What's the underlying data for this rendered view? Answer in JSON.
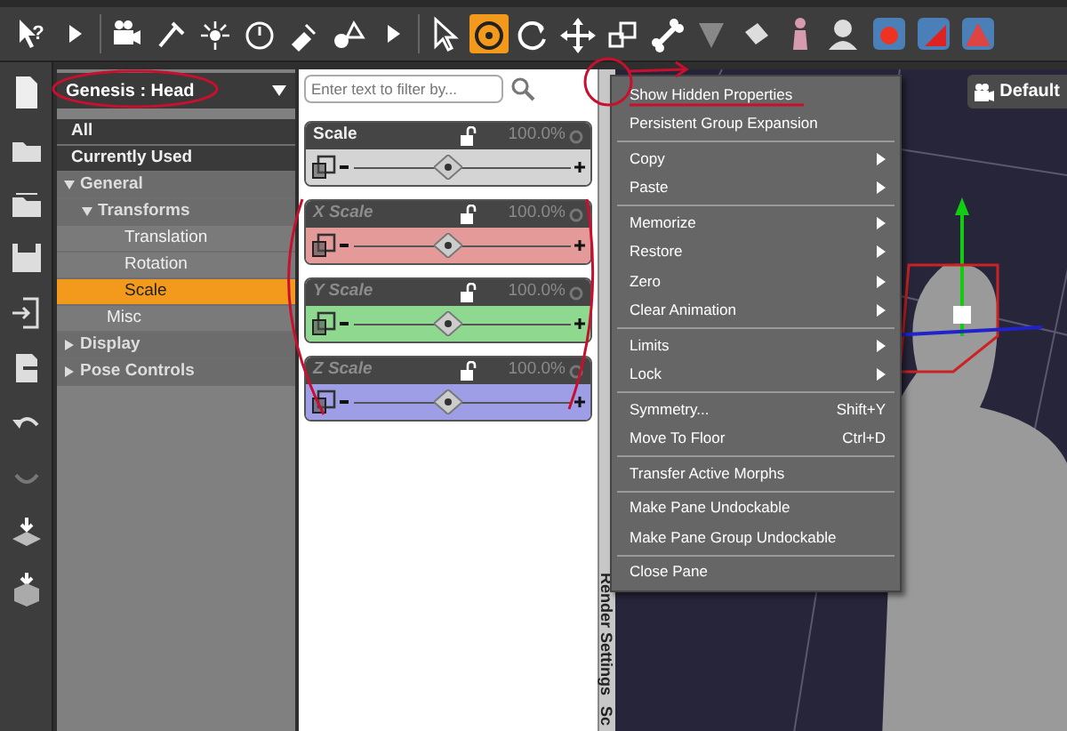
{
  "toolbar": {
    "tools": [
      {
        "selected": false,
        "label": "?"
      },
      {
        "selected": false
      },
      {
        "selected": false
      },
      {
        "selected": false
      },
      {
        "selected": false
      },
      {
        "selected": false
      },
      {
        "selected": false
      },
      {
        "selected": false
      },
      {
        "selected": false
      },
      {
        "selected": false
      },
      {
        "selected": true
      },
      {
        "selected": false
      },
      {
        "selected": false
      },
      {
        "selected": false
      },
      {
        "selected": false
      },
      {
        "selected": false
      },
      {
        "selected": false
      },
      {
        "selected": false
      },
      {
        "selected": false
      },
      {
        "selected": false
      },
      {
        "selected": false
      },
      {
        "selected": false
      }
    ]
  },
  "node_selector": {
    "value": "Genesis : Head"
  },
  "tree": [
    {
      "label": "All",
      "kind": "header",
      "selected": false
    },
    {
      "label": "Currently Used",
      "kind": "header",
      "selected": false
    },
    {
      "label": "General",
      "kind": "group",
      "expanded": true,
      "selected": false,
      "children": [
        {
          "label": "Transforms",
          "kind": "group",
          "expanded": true,
          "selected": false,
          "children": [
            {
              "label": "Translation",
              "kind": "leaf",
              "selected": false
            },
            {
              "label": "Rotation",
              "kind": "leaf",
              "selected": false
            },
            {
              "label": "Scale",
              "kind": "leaf",
              "selected": true
            }
          ]
        },
        {
          "label": "Misc",
          "kind": "leaf",
          "selected": false
        }
      ]
    },
    {
      "label": "Display",
      "kind": "group",
      "expanded": false,
      "selected": false
    },
    {
      "label": "Pose Controls",
      "kind": "group",
      "expanded": false,
      "selected": false
    }
  ],
  "filter": {
    "placeholder": "Enter text to filter by..."
  },
  "sliders": [
    {
      "label": "Scale",
      "value": "100.0%",
      "hidden": false,
      "color": "#d4d4d4",
      "level": 0.5
    },
    {
      "label": "X Scale",
      "value": "100.0%",
      "hidden": true,
      "color": "#e59a9a",
      "level": 0.5
    },
    {
      "label": "Y Scale",
      "value": "100.0%",
      "hidden": true,
      "color": "#8fd88f",
      "level": 0.5
    },
    {
      "label": "Z Scale",
      "value": "100.0%",
      "hidden": true,
      "color": "#9e9ee6",
      "level": 0.5
    }
  ],
  "side_tabs": [
    {
      "label": "Render Settings"
    },
    {
      "label": "Sc"
    }
  ],
  "viewport": {
    "camera": "Default"
  },
  "context_menu": [
    [
      {
        "label": "Show Hidden Properties",
        "submenu": false
      },
      {
        "label": "Persistent Group Expansion",
        "submenu": false
      }
    ],
    [
      {
        "label": "Copy",
        "submenu": true
      },
      {
        "label": "Paste",
        "submenu": true
      }
    ],
    [
      {
        "label": "Memorize",
        "submenu": true
      },
      {
        "label": "Restore",
        "submenu": true
      },
      {
        "label": "Zero",
        "submenu": true
      },
      {
        "label": "Clear Animation",
        "submenu": true
      }
    ],
    [
      {
        "label": "Limits",
        "submenu": true
      },
      {
        "label": "Lock",
        "submenu": true
      }
    ],
    [
      {
        "label": "Symmetry...",
        "shortcut": "Shift+Y",
        "submenu": false
      },
      {
        "label": "Move To Floor",
        "shortcut": "Ctrl+D",
        "submenu": false
      }
    ],
    [
      {
        "label": "Transfer Active Morphs",
        "submenu": false
      }
    ],
    [
      {
        "label": "Make Pane Undockable",
        "submenu": false
      },
      {
        "label": "Make Pane Group Undockable",
        "submenu": false
      }
    ],
    [
      {
        "label": "Close Pane",
        "submenu": false
      }
    ]
  ]
}
